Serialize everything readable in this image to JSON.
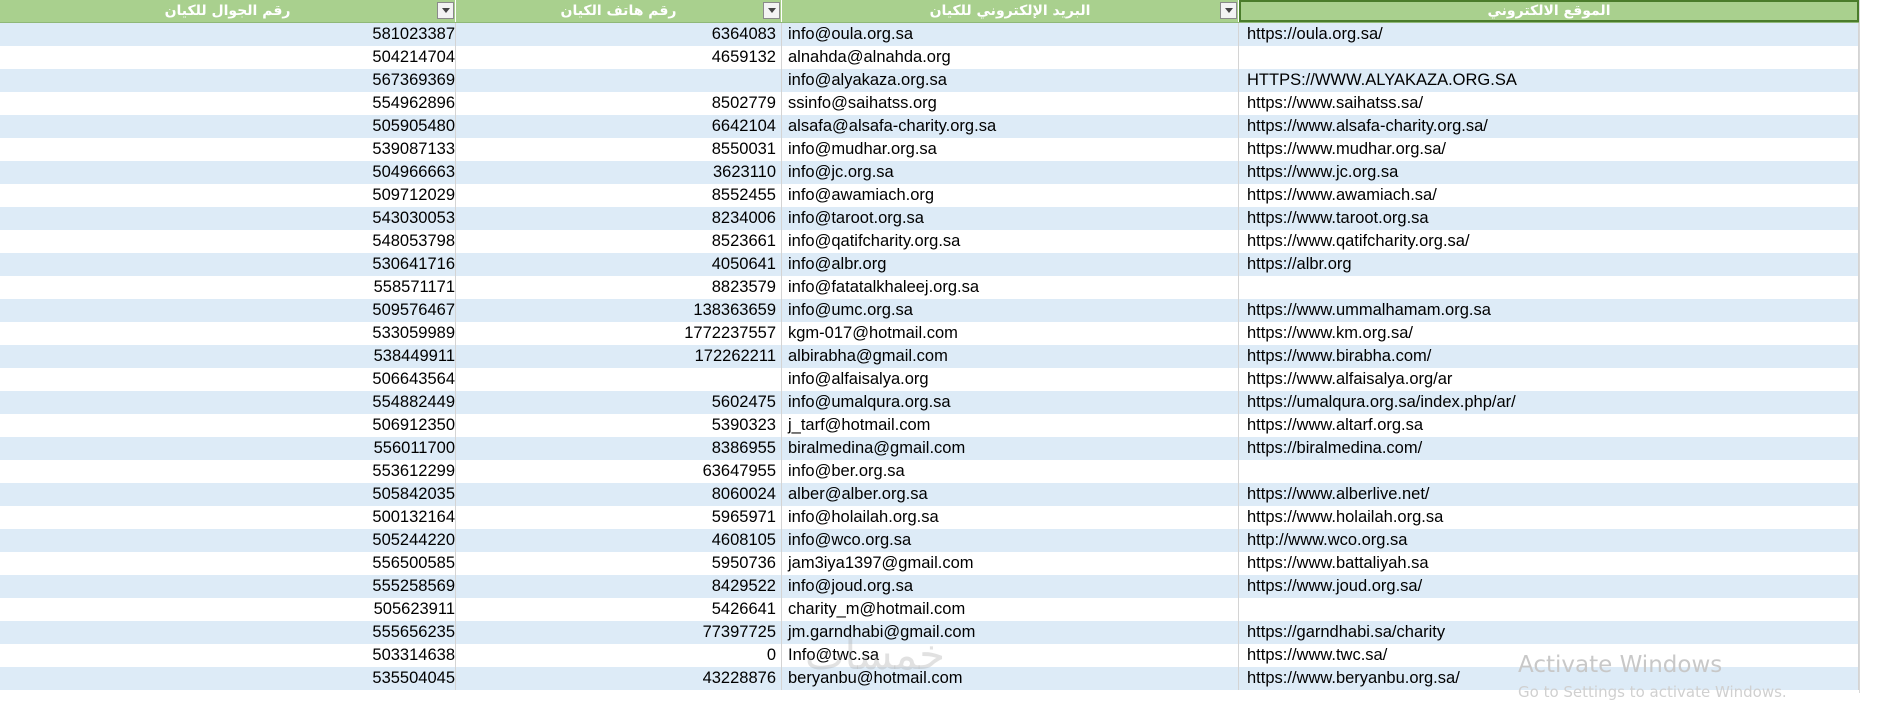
{
  "headers": {
    "mobile": "رقم الجوال للكيان",
    "phone": "رقم   هاتف الكيان",
    "email": "البريد الإلكتروني للكيان",
    "website": "الموقع الالكتروني"
  },
  "rows": [
    {
      "mobile": "581023387",
      "phone": "6364083",
      "email": "info@oula.org.sa",
      "website": "https://oula.org.sa/"
    },
    {
      "mobile": "504214704",
      "phone": "4659132",
      "email": "alnahda@alnahda.org",
      "website": ""
    },
    {
      "mobile": "567369369",
      "phone": "",
      "email": "info@alyakaza.org.sa",
      "website": "HTTPS://WWW.ALYAKAZA.ORG.SA"
    },
    {
      "mobile": "554962896",
      "phone": "8502779",
      "email": "ssinfo@saihatss.org",
      "website": "https://www.saihatss.sa/"
    },
    {
      "mobile": "505905480",
      "phone": "6642104",
      "email": "alsafa@alsafa-charity.org.sa",
      "website": "https://www.alsafa-charity.org.sa/"
    },
    {
      "mobile": "539087133",
      "phone": "8550031",
      "email": "info@mudhar.org.sa",
      "website": "https://www.mudhar.org.sa/"
    },
    {
      "mobile": "504966663",
      "phone": "3623110",
      "email": "info@jc.org.sa",
      "website": "https://www.jc.org.sa"
    },
    {
      "mobile": "509712029",
      "phone": "8552455",
      "email": "info@awamiach.org",
      "website": "https://www.awamiach.sa/"
    },
    {
      "mobile": "543030053",
      "phone": "8234006",
      "email": "info@taroot.org.sa",
      "website": "https://www.taroot.org.sa"
    },
    {
      "mobile": "548053798",
      "phone": "8523661",
      "email": "info@qatifcharity.org.sa",
      "website": "https://www.qatifcharity.org.sa/"
    },
    {
      "mobile": "530641716",
      "phone": "4050641",
      "email": "info@albr.org",
      "website": "https://albr.org"
    },
    {
      "mobile": "558571171",
      "phone": "8823579",
      "email": "info@fatatalkhaleej.org.sa",
      "website": ""
    },
    {
      "mobile": "509576467",
      "phone": "138363659",
      "email": "info@umc.org.sa",
      "website": "https://www.ummalhamam.org.sa"
    },
    {
      "mobile": "533059989",
      "phone": "1772237557",
      "email": "kgm-017@hotmail.com",
      "website": "https://www.km.org.sa/"
    },
    {
      "mobile": "538449911",
      "phone": "172262211",
      "email": "albirabha@gmail.com",
      "website": "https://www.birabha.com/"
    },
    {
      "mobile": "506643564",
      "phone": "",
      "email": "info@alfaisalya.org",
      "website": "https://www.alfaisalya.org/ar"
    },
    {
      "mobile": "554882449",
      "phone": "5602475",
      "email": "info@umalqura.org.sa",
      "website": "https://umalqura.org.sa/index.php/ar/"
    },
    {
      "mobile": "506912350",
      "phone": "5390323",
      "email": "j_tarf@hotmail.com",
      "website": "https://www.altarf.org.sa"
    },
    {
      "mobile": "556011700",
      "phone": "8386955",
      "email": "biralmedina@gmail.com",
      "website": "https://biralmedina.com/"
    },
    {
      "mobile": "553612299",
      "phone": "63647955",
      "email": "info@ber.org.sa",
      "website": ""
    },
    {
      "mobile": "505842035",
      "phone": "8060024",
      "email": "alber@alber.org.sa",
      "website": "https://www.alberlive.net/"
    },
    {
      "mobile": "500132164",
      "phone": "5965971",
      "email": "info@holailah.org.sa",
      "website": "https://www.holailah.org.sa"
    },
    {
      "mobile": "505244220",
      "phone": "4608105",
      "email": "info@wco.org.sa",
      "website": "http://www.wco.org.sa"
    },
    {
      "mobile": "556500585",
      "phone": "5950736",
      "email": "jam3iya1397@gmail.com",
      "website": "https://www.battaliyah.sa"
    },
    {
      "mobile": "555258569",
      "phone": "8429522",
      "email": "info@joud.org.sa",
      "website": "https://www.joud.org.sa/"
    },
    {
      "mobile": "505623911",
      "phone": "5426641",
      "email": "charity_m@hotmail.com",
      "website": ""
    },
    {
      "mobile": "555656235",
      "phone": "77397725",
      "email": "jm.garndhabi@gmail.com",
      "website": "https://garndhabi.sa/charity"
    },
    {
      "mobile": "503314638",
      "phone": "0",
      "email": "Info@twc.sa",
      "website": "https://www.twc.sa/"
    },
    {
      "mobile": "535504045",
      "phone": "43228876",
      "email": "beryanbu@hotmail.com",
      "website": "https://www.beryanbu.org.sa/"
    }
  ],
  "watermark": {
    "line1": "Activate Windows",
    "line2": "Go to Settings to activate Windows.",
    "logo": "خمسات"
  }
}
